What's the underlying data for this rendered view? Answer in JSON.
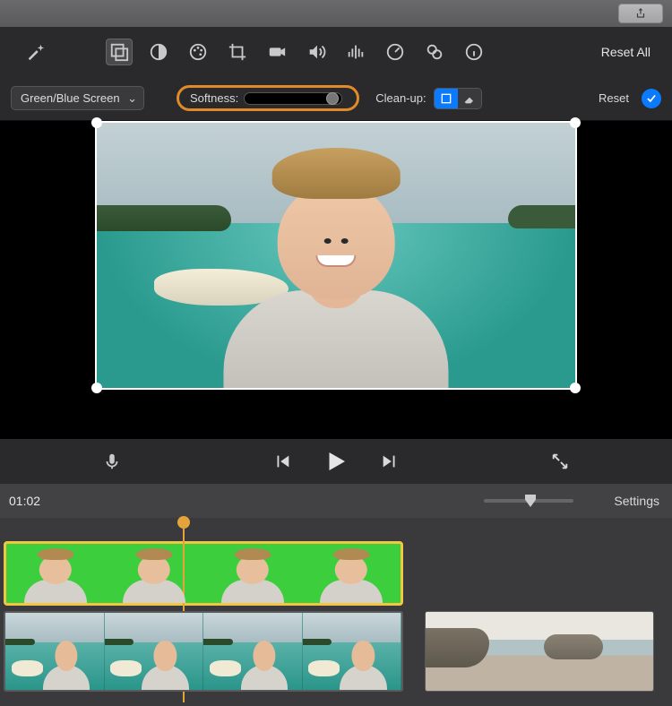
{
  "window": {
    "share_icon": "share"
  },
  "toolbar": {
    "wand_icon": "wand-icon",
    "overlay_icon": "overlay-icon",
    "contrast_icon": "contrast-icon",
    "palette_icon": "palette-icon",
    "crop_icon": "crop-icon",
    "camera_icon": "camera-icon",
    "volume_icon": "volume-icon",
    "eq_icon": "equalizer-icon",
    "speed_icon": "speedometer-icon",
    "shapes_icon": "shapes-icon",
    "info_icon": "info-icon",
    "reset_all_label": "Reset All"
  },
  "controls": {
    "overlay_mode": "Green/Blue Screen",
    "softness_label": "Softness:",
    "softness_value": 95,
    "cleanup_label": "Clean-up:",
    "reset_label": "Reset"
  },
  "transport": {
    "mic_icon": "microphone-icon",
    "prev_icon": "skip-back-icon",
    "play_icon": "play-icon",
    "next_icon": "skip-forward-icon",
    "expand_icon": "expand-icon"
  },
  "timeline": {
    "timecode": "01:02",
    "settings_label": "Settings",
    "zoom_value": 46
  }
}
